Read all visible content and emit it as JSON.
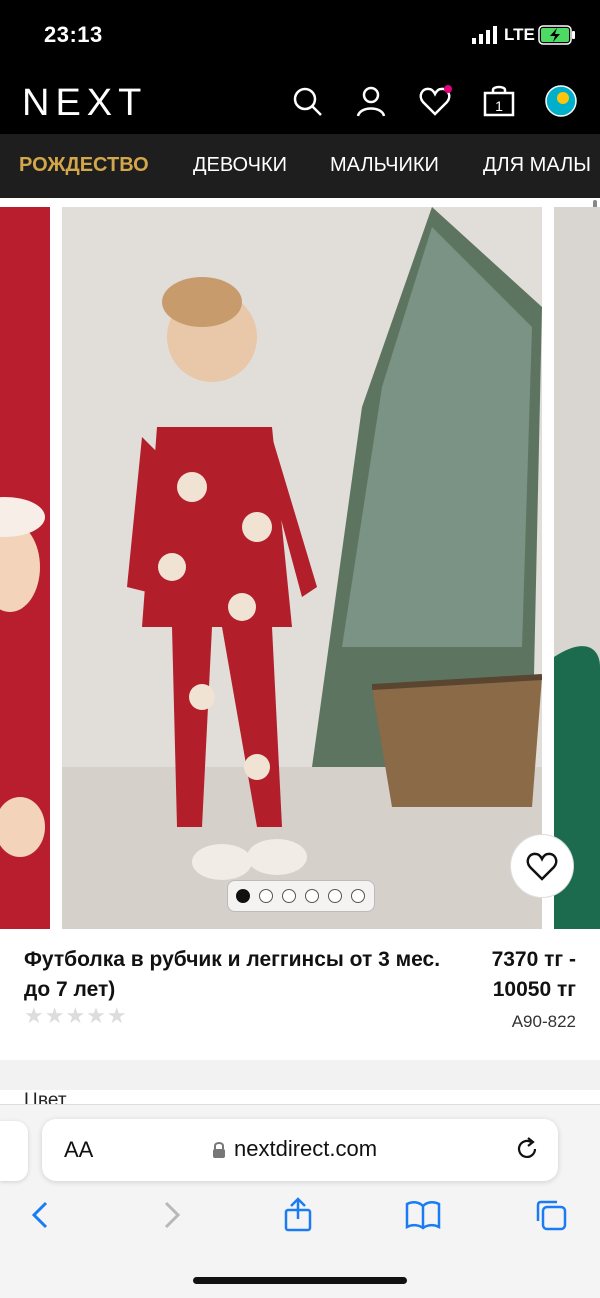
{
  "status_bar": {
    "time": "23:13",
    "network": "LTE"
  },
  "header": {
    "logo": "NEXT"
  },
  "nav": {
    "items": [
      "РОЖДЕСТВО",
      "ДЕВОЧКИ",
      "МАЛЬЧИКИ",
      "ДЛЯ МАЛЫ"
    ]
  },
  "product": {
    "title": "Футболка в рубчик и леггинсы от 3 мес. до 7 лет)",
    "price": "7370 тг - 10050 тг",
    "code": "A90-822",
    "rating_stars": 0,
    "color_label": "Цвет"
  },
  "gallery": {
    "images_count": 6,
    "active_index": 0
  },
  "browser": {
    "text_size": "AA",
    "url": "nextdirect.com"
  },
  "colors": {
    "accent": "#d2a64a",
    "header_bg": "#000000",
    "nav_bg": "#1e1e1e",
    "ios_blue": "#1a7cf5"
  }
}
